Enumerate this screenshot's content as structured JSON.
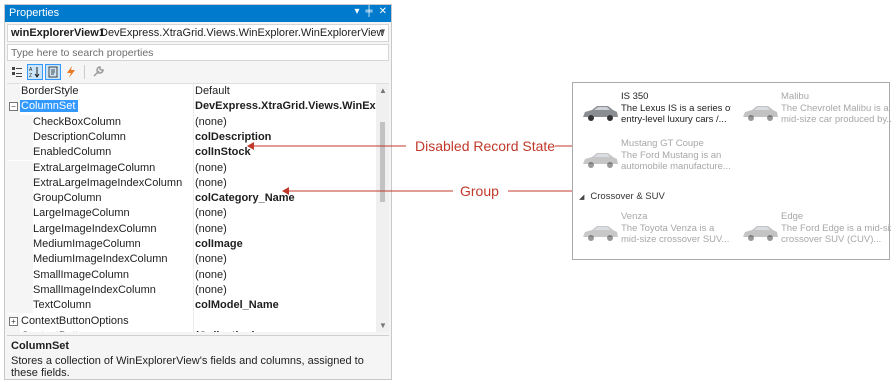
{
  "window": {
    "title": "Properties",
    "pin_glyph": "▾ ╪ ✕",
    "object_name": "winExplorerView1",
    "object_type": "DevExpress.XtraGrid.Views.WinExplorer.WinExplorerView",
    "search_placeholder": "Type here to search properties"
  },
  "toolbar": {
    "buttons": [
      {
        "icon": "categorized-icon",
        "active": false
      },
      {
        "icon": "alphabetical-icon",
        "active": true
      },
      {
        "icon": "properties-icon",
        "active": true
      },
      {
        "icon": "events-icon",
        "active": false
      },
      {
        "icon": "wrench-icon",
        "active": false
      }
    ]
  },
  "grid": {
    "rows": [
      {
        "name": "BorderStyle",
        "value": "Default",
        "bold": false,
        "level": 0,
        "expander": "",
        "selected": false
      },
      {
        "name": "ColumnSet",
        "value": "DevExpress.XtraGrid.Views.WinExplorer.\\",
        "bold": true,
        "level": 0,
        "expander": "−",
        "selected": true
      },
      {
        "name": "CheckBoxColumn",
        "value": "(none)",
        "bold": false,
        "level": 1,
        "expander": "",
        "selected": false
      },
      {
        "name": "DescriptionColumn",
        "value": "colDescription",
        "bold": true,
        "level": 1,
        "expander": "",
        "selected": false
      },
      {
        "name": "EnabledColumn",
        "value": "colInStock",
        "bold": true,
        "level": 1,
        "expander": "",
        "selected": false
      },
      {
        "name": "ExtraLargeImageColumn",
        "value": "(none)",
        "bold": false,
        "level": 1,
        "expander": "",
        "selected": false
      },
      {
        "name": "ExtraLargeImageIndexColumn",
        "value": "(none)",
        "bold": false,
        "level": 1,
        "expander": "",
        "selected": false
      },
      {
        "name": "GroupColumn",
        "value": "colCategory_Name",
        "bold": true,
        "level": 1,
        "expander": "",
        "selected": false
      },
      {
        "name": "LargeImageColumn",
        "value": "(none)",
        "bold": false,
        "level": 1,
        "expander": "",
        "selected": false
      },
      {
        "name": "LargeImageIndexColumn",
        "value": "(none)",
        "bold": false,
        "level": 1,
        "expander": "",
        "selected": false
      },
      {
        "name": "MediumImageColumn",
        "value": "colImage",
        "bold": true,
        "level": 1,
        "expander": "",
        "selected": false
      },
      {
        "name": "MediumImageIndexColumn",
        "value": "(none)",
        "bold": false,
        "level": 1,
        "expander": "",
        "selected": false
      },
      {
        "name": "SmallImageColumn",
        "value": "(none)",
        "bold": false,
        "level": 1,
        "expander": "",
        "selected": false
      },
      {
        "name": "SmallImageIndexColumn",
        "value": "(none)",
        "bold": false,
        "level": 1,
        "expander": "",
        "selected": false
      },
      {
        "name": "TextColumn",
        "value": "colModel_Name",
        "bold": true,
        "level": 1,
        "expander": "",
        "selected": false
      },
      {
        "name": "ContextButtonOptions",
        "value": "",
        "bold": false,
        "level": 0,
        "expander": "+",
        "selected": false
      },
      {
        "name": "ContextButtons",
        "value": "(Collection)",
        "bold": true,
        "level": 0,
        "expander": "",
        "selected": false
      }
    ]
  },
  "description": {
    "title": "ColumnSet",
    "text": "Stores a collection of WinExplorerView's fields and columns, assigned to these fields."
  },
  "callouts": {
    "disabled": "Disabled Record State",
    "group": "Group"
  },
  "explorer": {
    "group_label": "Crossover & SUV",
    "cards": [
      {
        "title": "IS 350",
        "desc1": "The Lexus IS is a series of",
        "desc2": "entry-level luxury cars /...",
        "enabled": true,
        "car_color": "#8a8d91"
      },
      {
        "title": "Malibu",
        "desc1": "The Chevrolet Malibu is a",
        "desc2": "mid-size car produced by...",
        "enabled": false,
        "car_color": "#9a9a9a"
      },
      {
        "title": "Mustang GT Coupe",
        "desc1": "The Ford Mustang is an",
        "desc2": "automobile manufacture...",
        "enabled": false,
        "car_color": "#a0a0a0"
      },
      {
        "title": "Venza",
        "desc1": "The Toyota Venza is a",
        "desc2": "mid-size crossover SUV...",
        "enabled": false,
        "car_color": "#a3a3a3"
      },
      {
        "title": "Edge",
        "desc1": "The Ford Edge is a mid-size",
        "desc2": "crossover SUV (CUV)...",
        "enabled": false,
        "car_color": "#9d9d9d"
      }
    ]
  },
  "colors": {
    "accent": "#007acc",
    "selection": "#3399ff",
    "callout": "#c0392b"
  }
}
